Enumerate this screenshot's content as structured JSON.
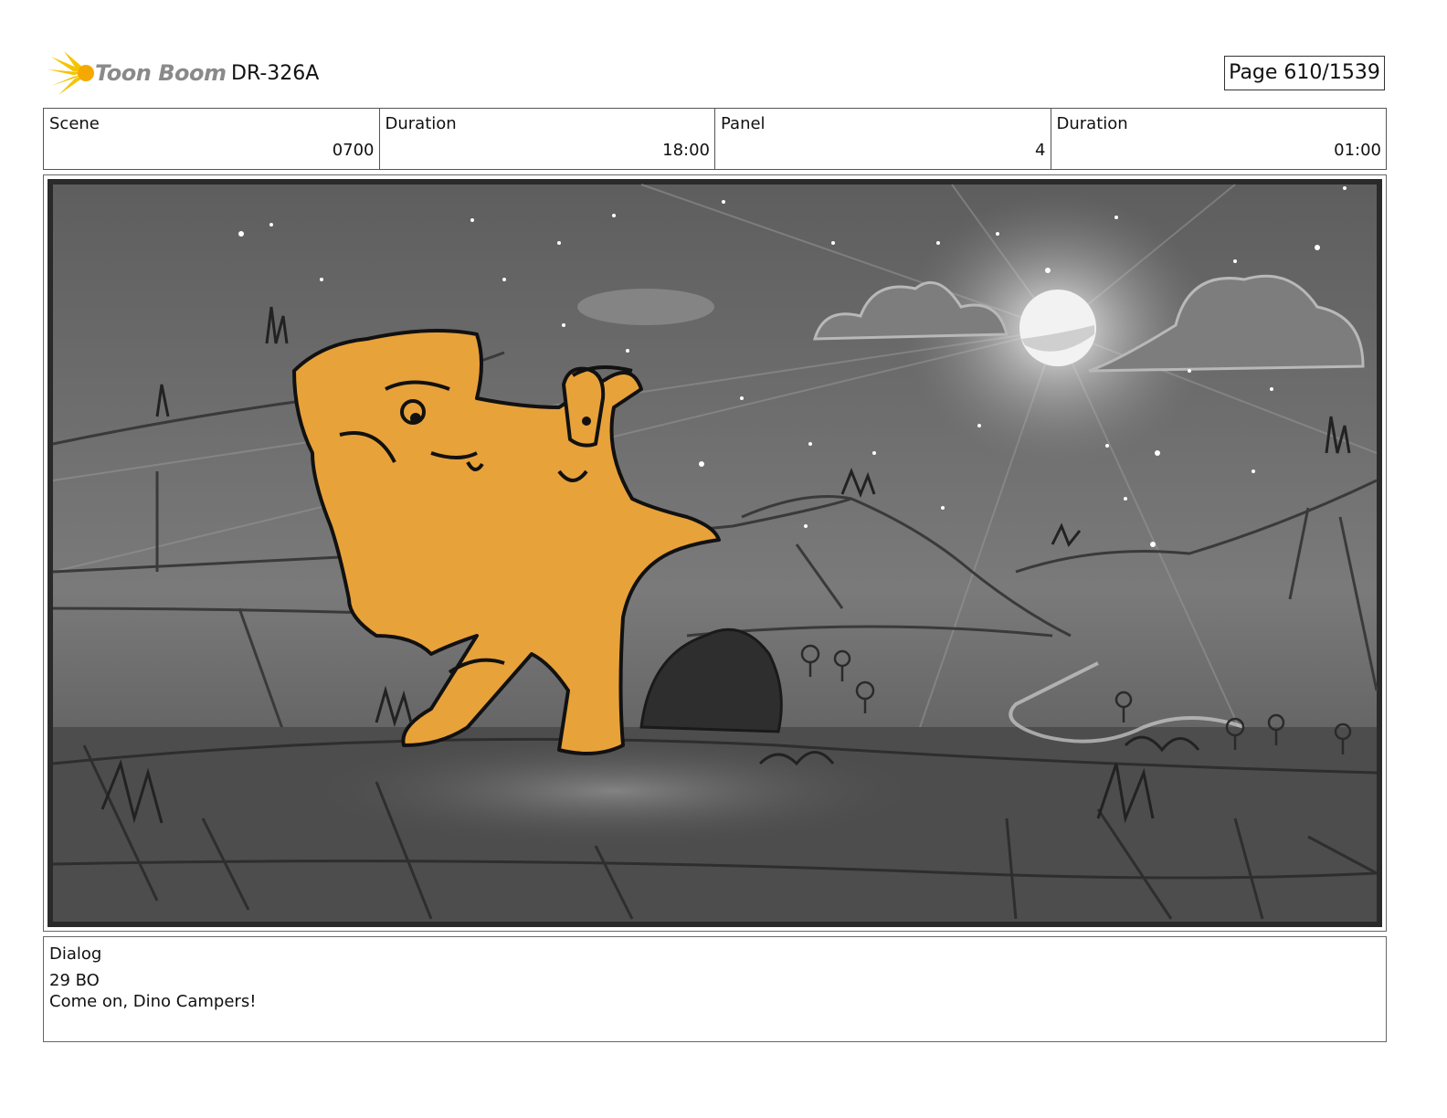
{
  "header": {
    "logo_text": "Toon Boom",
    "project_code": "DR-326A",
    "page_label": "Page  610/1539"
  },
  "info": {
    "scene_label": "Scene",
    "scene_value": "0700",
    "scene_duration_label": "Duration",
    "scene_duration_value": "18:00",
    "panel_label": "Panel",
    "panel_value": "4",
    "panel_duration_label": "Duration",
    "panel_duration_value": "01:00"
  },
  "dialog": {
    "label": "Dialog",
    "line1": "29 BO",
    "line2": "Come on, Dino Campers!"
  },
  "colors": {
    "dino": "#e8a23a",
    "logo_burst": "#f5c400",
    "sky": "#6a6a6a"
  }
}
